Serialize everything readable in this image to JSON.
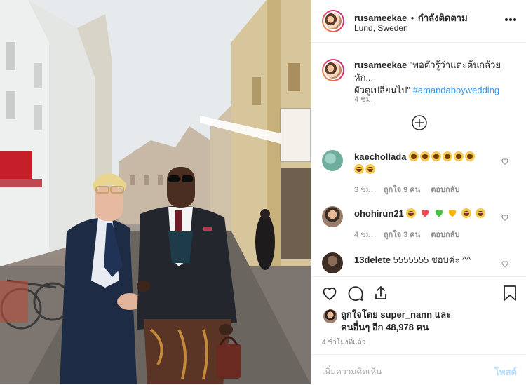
{
  "post": {
    "username": "rusameekae",
    "separator": "•",
    "follow_status": "กำลังติดตาม",
    "location": "Lund, Sweden",
    "more_icon": "more-horizontal-icon"
  },
  "caption": {
    "username": "rusameekae",
    "text_line1": "\"พอตัวรู้ว่าแตะต้นกล้วยหัก...",
    "text_line2": "ผัวดูเปลี่ยนไป\"",
    "hashtag": "#amandaboywedding",
    "time": "4 ชม."
  },
  "load_more_icon": "plus-circle-icon",
  "comments": [
    {
      "username": "kaechollada",
      "text": "",
      "emojis": [
        "tears-of-joy",
        "tears-of-joy",
        "tears-of-joy",
        "tears-of-joy",
        "tears-of-joy",
        "tears-of-joy",
        "tears-of-joy",
        "tears-of-joy"
      ],
      "time": "3 ชม.",
      "likes": "ถูกใจ 9 คน",
      "reply": "ตอบกลับ"
    },
    {
      "username": "ohohirun21",
      "text": "",
      "emojis": [
        "heart-eyes",
        "red-heart",
        "green-heart",
        "yellow-heart",
        "wink-kiss",
        "winking-tongue"
      ],
      "time": "4 ชม.",
      "likes": "ถูกใจ 3 คน",
      "reply": "ตอบกลับ"
    },
    {
      "username": "13delete",
      "text": "5555555 ชอบค่ะ ^^",
      "emojis": [],
      "time": "",
      "likes": "",
      "reply": ""
    }
  ],
  "actions": {
    "like_icon": "heart-icon",
    "comment_icon": "comment-icon",
    "share_icon": "share-icon",
    "save_icon": "bookmark-icon"
  },
  "liked_by": {
    "prefix": "ถูกใจโดย",
    "user": "super_nann",
    "and": "และ",
    "others_prefix": "คนอื่นๆ อีก",
    "count": "48,978",
    "others_suffix": "คน"
  },
  "posted_time": "4 ชั่วโมงที่แล้ว",
  "add_comment": {
    "placeholder": "เพิ่มความคิดเห็น",
    "post_label": "โพสต์"
  },
  "colors": {
    "link": "#3897f0",
    "post_disabled": "#b3dbff",
    "gray": "#8e8e8e",
    "red_heart": "#ed4956",
    "green_heart": "#48c13e",
    "yellow_heart": "#f7b500"
  }
}
